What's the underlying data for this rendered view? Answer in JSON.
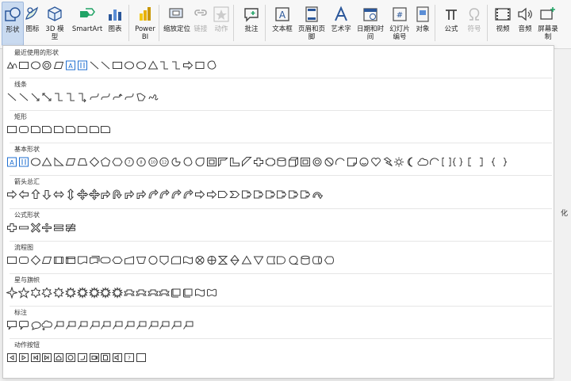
{
  "ribbon": {
    "buttons": [
      {
        "id": "shapes",
        "label": "形状",
        "icon": "shapes-icon",
        "selected": true,
        "disabled": false
      },
      {
        "id": "icons",
        "label": "图标",
        "icon": "icons-icon",
        "selected": false,
        "disabled": false
      },
      {
        "id": "models3d",
        "label": "3D 模型",
        "icon": "cube-icon",
        "selected": false,
        "disabled": false
      },
      {
        "id": "smartart",
        "label": "SmartArt",
        "icon": "smartart-icon",
        "selected": false,
        "disabled": false
      },
      {
        "id": "chart",
        "label": "图表",
        "icon": "chart-icon",
        "selected": false,
        "disabled": false
      },
      {
        "id": "powerbi",
        "label": "Power BI",
        "icon": "powerbi-icon",
        "selected": false,
        "disabled": false
      },
      {
        "id": "zoom",
        "label": "缩放定位",
        "icon": "zoom-icon",
        "selected": false,
        "disabled": false
      },
      {
        "id": "link",
        "label": "链接",
        "icon": "link-icon",
        "selected": false,
        "disabled": true
      },
      {
        "id": "action",
        "label": "动作",
        "icon": "star-action-icon",
        "selected": false,
        "disabled": true
      },
      {
        "id": "comment",
        "label": "批注",
        "icon": "comment-icon",
        "selected": false,
        "disabled": false
      },
      {
        "id": "textbox",
        "label": "文本框",
        "icon": "textbox-icon",
        "selected": false,
        "disabled": false
      },
      {
        "id": "headerfooter",
        "label": "页眉和页脚",
        "icon": "header-footer-icon",
        "selected": false,
        "disabled": false
      },
      {
        "id": "wordart",
        "label": "艺术字",
        "icon": "wordart-icon",
        "selected": false,
        "disabled": false
      },
      {
        "id": "datetime",
        "label": "日期和时间",
        "icon": "calendar-icon",
        "selected": false,
        "disabled": false
      },
      {
        "id": "slidenumber",
        "label": "幻灯片编号",
        "icon": "slide-number-icon",
        "selected": false,
        "disabled": false
      },
      {
        "id": "object",
        "label": "对象",
        "icon": "object-icon",
        "selected": false,
        "disabled": false
      },
      {
        "id": "equation",
        "label": "公式",
        "icon": "pi-icon",
        "selected": false,
        "disabled": false
      },
      {
        "id": "symbol",
        "label": "符号",
        "icon": "omega-icon",
        "selected": false,
        "disabled": true
      },
      {
        "id": "video",
        "label": "视频",
        "icon": "video-icon",
        "selected": false,
        "disabled": false
      },
      {
        "id": "audio",
        "label": "音频",
        "icon": "speaker-icon",
        "selected": false,
        "disabled": false
      },
      {
        "id": "screenrec",
        "label": "屏幕录制",
        "icon": "screen-record-icon",
        "selected": false,
        "disabled": false
      }
    ]
  },
  "gallery": {
    "sections": [
      {
        "title": "最近使用的形状",
        "shapes": [
          "rtriangle-tri",
          "rect",
          "oval",
          "donut",
          "parallelogram",
          "textbox-a",
          "vtextbox",
          "line",
          "line",
          "rect",
          "oval",
          "oval",
          "triangle",
          "elbow",
          "elbow",
          "rarrow",
          "curvedarrow",
          "chord"
        ]
      },
      {
        "title": "线条",
        "shapes": [
          "line",
          "line",
          "arrow-line",
          "dbl-arrow-line",
          "elbow",
          "elbow",
          "elbow-arrow",
          "curve",
          "curve",
          "curve-arrow",
          "curve",
          "freeform",
          "scribble"
        ]
      },
      {
        "title": "矩形",
        "shapes": [
          "rect",
          "rounded-rect",
          "snip1",
          "snip2",
          "snip3",
          "snip4",
          "round1",
          "round2",
          "round3"
        ]
      },
      {
        "title": "基本形状",
        "shapes": [
          "textbox-a",
          "vtextbox",
          "oval",
          "triangle",
          "rtriangle",
          "parallelogram",
          "trapezoid",
          "diamond",
          "pentagon",
          "hexagon",
          "heptagon",
          "octagon",
          "decagon",
          "dodecagon",
          "pie",
          "chord",
          "teardrop",
          "frame",
          "halfframe",
          "lshape",
          "diagstripe",
          "cross",
          "plaque",
          "can",
          "cube",
          "bevel",
          "donut",
          "nosymbol",
          "arc",
          "foldedcorner",
          "smiley",
          "heart",
          "lightning",
          "sun",
          "moon",
          "cloud",
          "arc",
          "bracketpair",
          "bracepair",
          "lbracket",
          "rbracket",
          "lbrace",
          "rbrace"
        ]
      },
      {
        "title": "箭头总汇",
        "shapes": [
          "rarrow",
          "larrow",
          "uarrow",
          "darrow",
          "lrarrow",
          "udarrow",
          "quadarrow",
          "lrudarrow",
          "bentarrow",
          "uturn",
          "leftup",
          "bentup",
          "curvedr",
          "curvedl",
          "curvedu",
          "curvedd",
          "stripedr",
          "notchedr",
          "pentagonarrow",
          "chevron",
          "rcallout",
          "dcallout",
          "lcallout",
          "ucallout",
          "lrcallout",
          "quadcallout",
          "circulararrow"
        ]
      },
      {
        "title": "公式形状",
        "shapes": [
          "plus",
          "minus",
          "multiply",
          "divide",
          "equal",
          "notequal"
        ]
      },
      {
        "title": "流程图",
        "shapes": [
          "rect",
          "rounded-rect",
          "diamond",
          "parallelogram",
          "predefined",
          "internal",
          "document",
          "multidoc",
          "terminator",
          "preparation",
          "manualinput",
          "manualop",
          "connector",
          "offpage",
          "card",
          "punchedtape",
          "summing",
          "or",
          "collate",
          "sort",
          "extract",
          "merge",
          "storeddata",
          "delay",
          "sequential",
          "magnetic",
          "direct",
          "display"
        ]
      },
      {
        "title": "星与旗帜",
        "shapes": [
          "star4",
          "star5",
          "star6",
          "star7",
          "star8",
          "star10",
          "star12",
          "star16",
          "star24",
          "star32",
          "ribbon",
          "ribbon2",
          "ribbon3",
          "ribbon4",
          "scroll",
          "scroll2",
          "wave",
          "dblwave"
        ]
      },
      {
        "title": "标注",
        "shapes": [
          "wedgerect",
          "wedgerrect",
          "wedgeoval",
          "cloudcallout",
          "callout1",
          "callout2",
          "callout3",
          "callout4",
          "callout5",
          "callout6",
          "callout7",
          "callout8",
          "callout9",
          "callout10",
          "callout11",
          "callout12"
        ]
      },
      {
        "title": "动作按钮",
        "shapes": [
          "btn-back",
          "btn-fwd",
          "btn-begin",
          "btn-end",
          "btn-home",
          "btn-info",
          "btn-return",
          "btn-movie",
          "btn-doc",
          "btn-sound",
          "btn-help",
          "btn-blank"
        ]
      }
    ]
  },
  "right_doc": {
    "char": "化"
  },
  "colors": {
    "accent": "#2b579a",
    "shape_stroke": "#3a3a3a",
    "textbox_fill": "#1f6fd0",
    "selected_bg": "#c9daf0"
  }
}
